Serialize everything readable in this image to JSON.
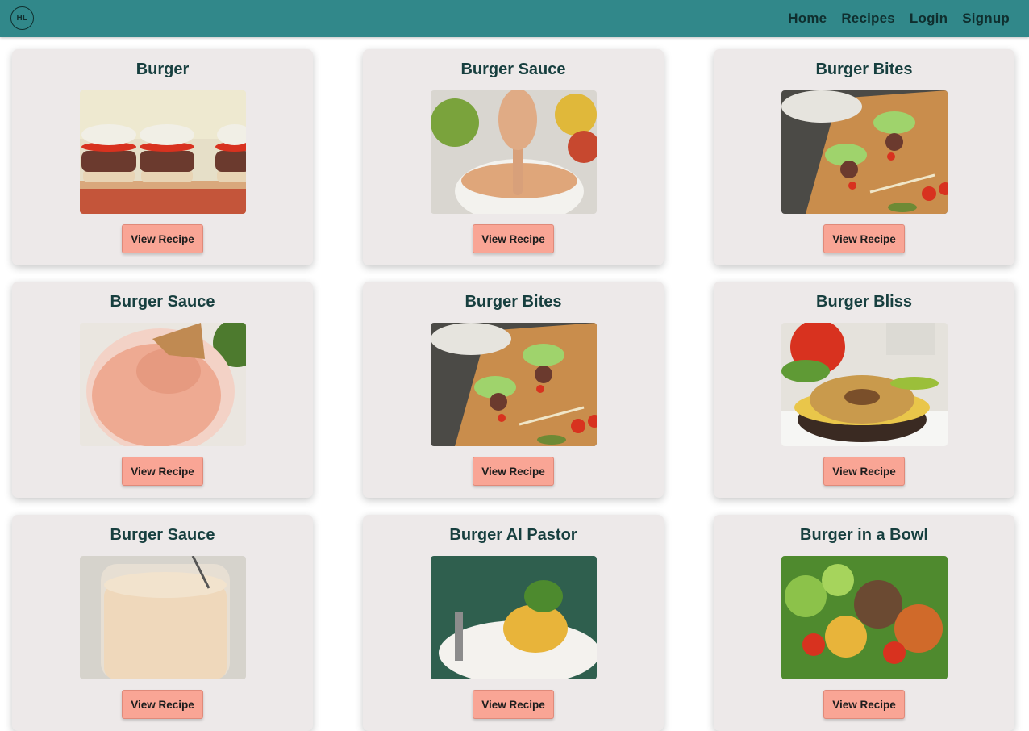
{
  "nav": {
    "logo": "HL",
    "links": [
      "Home",
      "Recipes",
      "Login",
      "Signup"
    ]
  },
  "cards": [
    {
      "title": "Burger",
      "button": "View Recipe"
    },
    {
      "title": "Burger Sauce",
      "button": "View Recipe"
    },
    {
      "title": "Burger Bites",
      "button": "View Recipe"
    },
    {
      "title": "Burger Sauce",
      "button": "View Recipe"
    },
    {
      "title": "Burger Bites",
      "button": "View Recipe"
    },
    {
      "title": "Burger Bliss",
      "button": "View Recipe"
    },
    {
      "title": "Burger Sauce",
      "button": "View Recipe"
    },
    {
      "title": "Burger Al Pastor",
      "button": "View Recipe"
    },
    {
      "title": "Burger in a Bowl",
      "button": "View Recipe"
    }
  ],
  "colors": {
    "navbar": "#31888a",
    "card": "#ede9e9",
    "button": "#f9a595",
    "title": "#173f3f"
  }
}
